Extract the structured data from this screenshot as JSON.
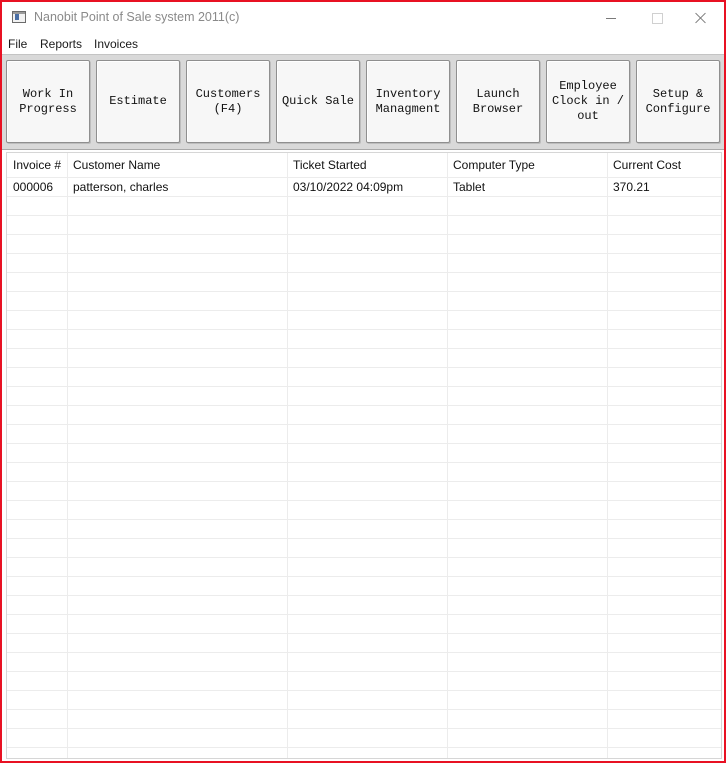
{
  "window": {
    "title": "Nanobit Point of Sale system 2011(c)"
  },
  "menu": {
    "file": "File",
    "reports": "Reports",
    "invoices": "Invoices"
  },
  "toolbar": {
    "buttons": [
      {
        "label": "Work In\nProgress"
      },
      {
        "label": "Estimate"
      },
      {
        "label": "Customers\n(F4)"
      },
      {
        "label": "Quick Sale"
      },
      {
        "label": "Inventory\nManagment"
      },
      {
        "label": "Launch\nBrowser"
      },
      {
        "label": "Employee\nClock in /\nout"
      },
      {
        "label": "Setup &\nConfigure"
      }
    ]
  },
  "table": {
    "columns": [
      "Invoice #",
      "Customer Name",
      "Ticket Started",
      "Computer Type",
      "Current Cost"
    ],
    "rows": [
      {
        "invoice": "000006",
        "customer": "patterson, charles",
        "started": "03/10/2022 04:09pm",
        "type": "Tablet",
        "cost": "370.21"
      }
    ]
  },
  "colors": {
    "window_border": "#e81123",
    "toolbar_bg": "#d9d9d9",
    "button_bg": "#f7f7f7"
  }
}
